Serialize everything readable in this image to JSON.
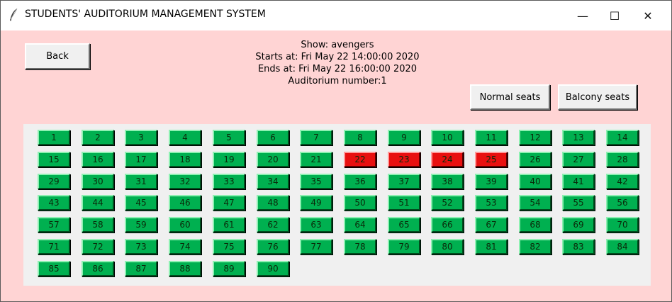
{
  "window": {
    "title": "STUDENTS' AUDITORIUM MANAGEMENT SYSTEM",
    "minimize_glyph": "—",
    "maximize_glyph": "☐",
    "close_glyph": "✕"
  },
  "colors": {
    "background": "#ffd4d4",
    "seat_panel": "#f0f0f0",
    "seat_available": "#00b050",
    "seat_booked": "#e81010"
  },
  "back_label": "Back",
  "info": {
    "show": "Show: avengers",
    "starts": "Starts at: Fri May 22 14:00:00 2020",
    "ends": "Ends at: Fri May 22 16:00:00 2020",
    "auditorium": "Auditorium number:1"
  },
  "buttons": {
    "normal_seats": "Normal seats",
    "balcony_seats": "Balcony seats"
  },
  "seats": {
    "total": 90,
    "per_row": 14,
    "booked": [
      22,
      23,
      24,
      25
    ]
  }
}
